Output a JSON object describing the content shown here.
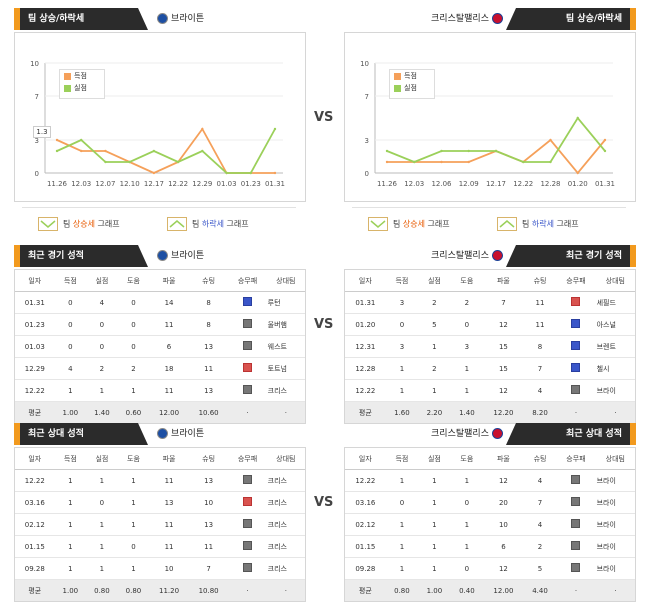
{
  "vs_label": "VS",
  "home": {
    "name": "브라이튼",
    "logo_color": "#1d4fa3",
    "trend": {
      "tab": "팀 상승/하락세",
      "legend": [
        "득점",
        "실점"
      ],
      "y_ticks": [
        "10",
        "7",
        "3",
        "0"
      ],
      "dates": [
        "11.26",
        "12.03",
        "12.07",
        "12.10",
        "12.17",
        "12.22",
        "12.29",
        "01.03",
        "01.23",
        "01.31"
      ],
      "callout": "1.3",
      "key_up": [
        "팀 ",
        "상승세",
        " 그래프"
      ],
      "key_down": [
        "팀 ",
        "하락세",
        " 그래프"
      ]
    },
    "recent": {
      "tab": "최근 경기 성적",
      "headers": [
        "일자",
        "득점",
        "실점",
        "도움",
        "파울",
        "슈팅",
        "승무패",
        "상대팀"
      ],
      "rows": [
        [
          "01.31",
          "0",
          "4",
          "0",
          "14",
          "8",
          "L",
          "루턴"
        ],
        [
          "01.23",
          "0",
          "0",
          "0",
          "11",
          "8",
          "D",
          "울버햄"
        ],
        [
          "01.03",
          "0",
          "0",
          "0",
          "6",
          "13",
          "D",
          "웨스트"
        ],
        [
          "12.29",
          "4",
          "2",
          "2",
          "18",
          "11",
          "W",
          "토트넘"
        ],
        [
          "12.22",
          "1",
          "1",
          "1",
          "11",
          "13",
          "D",
          "크리스"
        ]
      ],
      "avg": [
        "평균",
        "1.00",
        "1.40",
        "0.60",
        "12.00",
        "10.60",
        "·",
        "·"
      ]
    },
    "h2h": {
      "tab": "최근 상대 성적",
      "headers": [
        "일자",
        "득점",
        "실점",
        "도움",
        "파울",
        "슈팅",
        "승무패",
        "상대팀"
      ],
      "rows": [
        [
          "12.22",
          "1",
          "1",
          "1",
          "11",
          "13",
          "D",
          "크리스"
        ],
        [
          "03.16",
          "1",
          "0",
          "1",
          "13",
          "10",
          "W",
          "크리스"
        ],
        [
          "02.12",
          "1",
          "1",
          "1",
          "11",
          "13",
          "D",
          "크리스"
        ],
        [
          "01.15",
          "1",
          "1",
          "0",
          "11",
          "11",
          "D",
          "크리스"
        ],
        [
          "09.28",
          "1",
          "1",
          "1",
          "10",
          "7",
          "D",
          "크리스"
        ]
      ],
      "avg": [
        "평균",
        "1.00",
        "0.80",
        "0.80",
        "11.20",
        "10.80",
        "·",
        "·"
      ]
    }
  },
  "away": {
    "name": "크리스탈팰리스",
    "logo_color": "#c8102e",
    "trend": {
      "tab": "팀 상승/하락세",
      "legend": [
        "득점",
        "실점"
      ],
      "y_ticks": [
        "10",
        "7",
        "3",
        "0"
      ],
      "dates": [
        "11.26",
        "12.03",
        "12.06",
        "12.09",
        "12.17",
        "12.22",
        "12.28",
        "01.20",
        "01.31"
      ],
      "key_up": [
        "팀 ",
        "상승세",
        " 그래프"
      ],
      "key_down": [
        "팀 ",
        "하락세",
        " 그래프"
      ]
    },
    "recent": {
      "tab": "최근 경기 성적",
      "headers": [
        "일자",
        "득점",
        "실점",
        "도움",
        "파울",
        "슈팅",
        "승무패",
        "상대팀"
      ],
      "rows": [
        [
          "01.31",
          "3",
          "2",
          "2",
          "7",
          "11",
          "W",
          "셰필드"
        ],
        [
          "01.20",
          "0",
          "5",
          "0",
          "12",
          "11",
          "L",
          "아스널"
        ],
        [
          "12.31",
          "3",
          "1",
          "3",
          "15",
          "8",
          "L",
          "브렌트"
        ],
        [
          "12.28",
          "1",
          "2",
          "1",
          "15",
          "7",
          "L",
          "첼시"
        ],
        [
          "12.22",
          "1",
          "1",
          "1",
          "12",
          "4",
          "D",
          "브라이"
        ]
      ],
      "avg": [
        "평균",
        "1.60",
        "2.20",
        "1.40",
        "12.20",
        "8.20",
        "·",
        "·"
      ]
    },
    "h2h": {
      "tab": "최근 상대 성적",
      "headers": [
        "일자",
        "득점",
        "실점",
        "도움",
        "파울",
        "슈팅",
        "승무패",
        "상대팀"
      ],
      "rows": [
        [
          "12.22",
          "1",
          "1",
          "1",
          "12",
          "4",
          "D",
          "브라이"
        ],
        [
          "03.16",
          "0",
          "1",
          "0",
          "20",
          "7",
          "D",
          "브라이"
        ],
        [
          "02.12",
          "1",
          "1",
          "1",
          "10",
          "4",
          "D",
          "브라이"
        ],
        [
          "01.15",
          "1",
          "1",
          "1",
          "6",
          "2",
          "D",
          "브라이"
        ],
        [
          "09.28",
          "1",
          "1",
          "0",
          "12",
          "5",
          "D",
          "브라이"
        ]
      ],
      "avg": [
        "평균",
        "0.80",
        "1.00",
        "0.40",
        "12.00",
        "4.40",
        "·",
        "·"
      ]
    }
  },
  "chart_data": [
    {
      "type": "line",
      "x": [
        "11.26",
        "12.03",
        "12.07",
        "12.10",
        "12.17",
        "12.22",
        "12.29",
        "01.03",
        "01.23",
        "01.31"
      ],
      "ylim": [
        0,
        10
      ],
      "series": [
        {
          "name": "득점",
          "color": "#f5a05a",
          "values": [
            3,
            2,
            2,
            1,
            0,
            1,
            4,
            0,
            0,
            0
          ]
        },
        {
          "name": "실점",
          "color": "#9bd05a",
          "values": [
            2,
            3,
            1,
            1,
            2,
            1,
            2,
            0,
            0,
            4
          ]
        }
      ]
    },
    {
      "type": "line",
      "x": [
        "11.26",
        "12.03",
        "12.06",
        "12.09",
        "12.17",
        "12.22",
        "12.28",
        "01.20",
        "01.31"
      ],
      "ylim": [
        0,
        10
      ],
      "series": [
        {
          "name": "득점",
          "color": "#f5a05a",
          "values": [
            1,
            1,
            1,
            1,
            2,
            1,
            3,
            0,
            3
          ]
        },
        {
          "name": "실점",
          "color": "#9bd05a",
          "values": [
            2,
            1,
            2,
            2,
            2,
            1,
            1,
            5,
            2
          ]
        }
      ]
    }
  ]
}
